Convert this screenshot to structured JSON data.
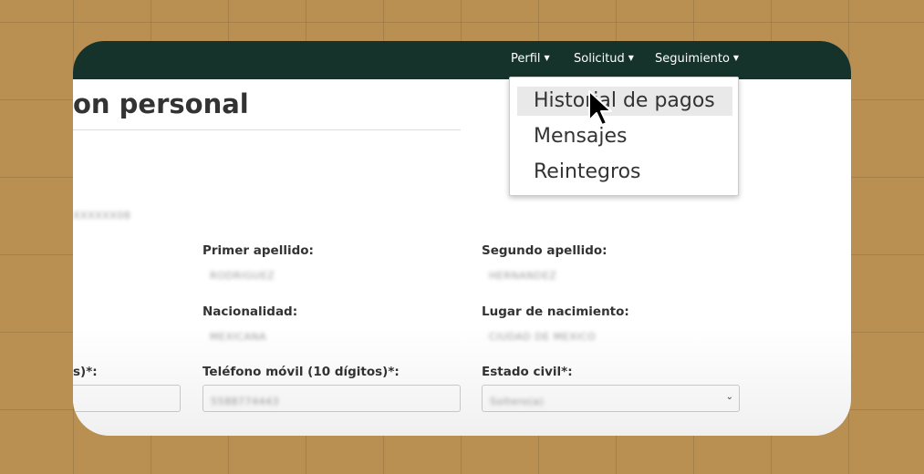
{
  "nav": {
    "items": [
      {
        "label": "Perfil"
      },
      {
        "label": "Solicitud"
      },
      {
        "label": "Seguimiento"
      }
    ]
  },
  "dropdown": {
    "items": [
      {
        "label": "Historial de pagos"
      },
      {
        "label": "Mensajes"
      },
      {
        "label": "Reintegros"
      }
    ]
  },
  "page": {
    "title": "on personal",
    "blurred_id": "XXXXXX08"
  },
  "form": {
    "primer_apellido": {
      "label": "Primer apellido:",
      "value": "RODRIGUEZ"
    },
    "segundo_apellido": {
      "label": "Segundo apellido:",
      "value": "HERNANDEZ"
    },
    "nacionalidad": {
      "label": "Nacionalidad:",
      "value": "MEXICANA"
    },
    "lugar_nacimiento": {
      "label": "Lugar de nacimiento:",
      "value": "CIUDAD DE MEXICO"
    },
    "telefono_fijo": {
      "label": "s)*:",
      "value": ""
    },
    "telefono_movil": {
      "label": "Teléfono móvil (10 dígitos)*:",
      "value": "5588774443"
    },
    "estado_civil": {
      "label": "Estado civil*:",
      "value": "Soltero(a)"
    }
  },
  "colors": {
    "navbar": "#15332b",
    "background": "#b98f52",
    "dropdown_active": "#e9e9e9"
  },
  "icons": {
    "caret": "caret-down-icon",
    "cursor": "mouse-pointer-icon",
    "select_arrow": "chevron-down-icon"
  }
}
